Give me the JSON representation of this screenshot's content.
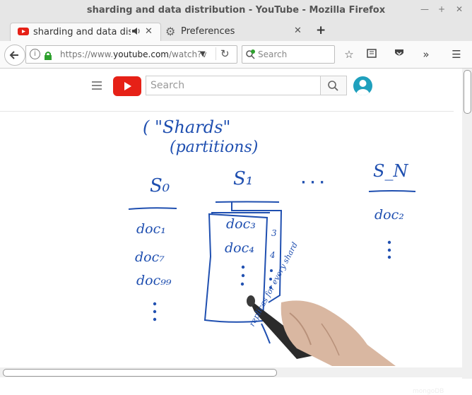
{
  "window": {
    "title": "sharding and data distribution - YouTube - Mozilla Firefox"
  },
  "tabs": [
    {
      "label": "sharding and data dis..."
    },
    {
      "label": "Preferences"
    }
  ],
  "navbar": {
    "url_prefix": "https://www.",
    "url_domain": "youtube.com",
    "url_suffix": "/watch?v",
    "search_placeholder": "Search"
  },
  "youtube": {
    "search_placeholder": "Search"
  },
  "video": {
    "watermark": "mongoDB",
    "notes": {
      "shards": "( \"Shards\"",
      "partitions": "(partitions)",
      "s0": "S₀",
      "s1": "S₁",
      "dots": "· · ·",
      "sn": "S_N",
      "doc1": "doc₁",
      "doc7": "doc₇",
      "doc99": "doc₉₉",
      "doc3": "doc₃",
      "doc4": "doc₄",
      "doc2": "doc₂",
      "side_note": "replicas for every shard",
      "num3": "3",
      "num4": "4"
    }
  },
  "colors": {
    "ink": "#1f4fb0",
    "youtube_red": "#e62117",
    "avatar": "#1fa0bd"
  }
}
